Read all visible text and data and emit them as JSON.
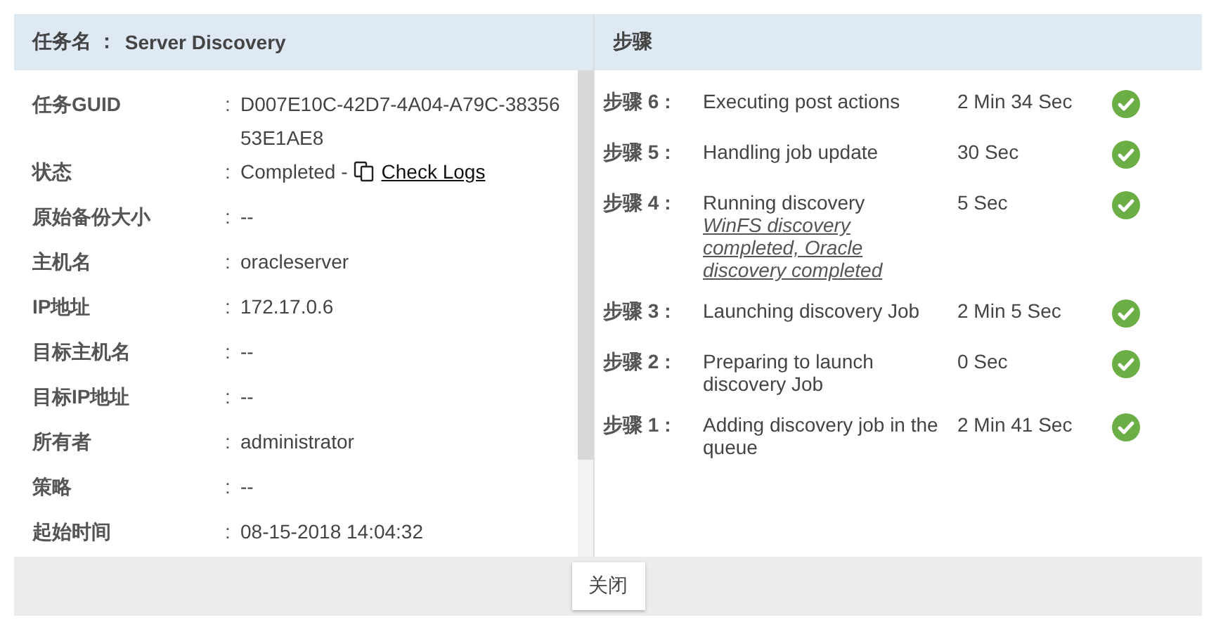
{
  "task_title": {
    "label": "任务名 ：",
    "value": "Server Discovery"
  },
  "details": [
    {
      "kind": "text",
      "label": "任务GUID",
      "separator": ":",
      "value": "D007E10C-42D7-4A04-A79C-3835653E1AE8"
    },
    {
      "kind": "status",
      "label": "状态",
      "separator": ":",
      "value": "Completed -",
      "link": "Check Logs"
    },
    {
      "kind": "text",
      "label": "原始备份大小",
      "separator": ":",
      "value": "--"
    },
    {
      "kind": "text",
      "label": "主机名",
      "separator": ":",
      "value": "oracleserver"
    },
    {
      "kind": "text",
      "label": "IP地址",
      "separator": ":",
      "value": "172.17.0.6"
    },
    {
      "kind": "text",
      "label": "目标主机名",
      "separator": ":",
      "value": "--"
    },
    {
      "kind": "text",
      "label": "目标IP地址",
      "separator": ":",
      "value": "--"
    },
    {
      "kind": "text",
      "label": "所有者",
      "separator": ":",
      "value": "administrator"
    },
    {
      "kind": "text",
      "label": "策略",
      "separator": ":",
      "value": "--"
    },
    {
      "kind": "text",
      "label": "起始时间",
      "separator": ":",
      "value": "08-15-2018 14:04:32"
    }
  ],
  "steps_title": "步骤",
  "steps": [
    {
      "label": "步骤 6 :",
      "description": "Executing post actions",
      "duration": "2 Min 34 Sec",
      "done": true
    },
    {
      "label": "步骤 5 :",
      "description": "Handling job update",
      "duration": "30 Sec",
      "done": true
    },
    {
      "label": "步骤 4 :",
      "description": "Running discovery",
      "note": "WinFS discovery completed, Oracle discovery completed",
      "duration": "5 Sec",
      "done": true
    },
    {
      "label": "步骤 3 :",
      "description": "Launching discovery Job",
      "duration": "2 Min 5 Sec",
      "done": true
    },
    {
      "label": "步骤 2 :",
      "description": "Preparing to launch discovery Job",
      "duration": "0 Sec",
      "done": true
    },
    {
      "label": "步骤 1 :",
      "description": "Adding discovery job in the queue",
      "duration": "2 Min 41 Sec",
      "done": true
    }
  ],
  "footer": {
    "button": "关闭"
  }
}
